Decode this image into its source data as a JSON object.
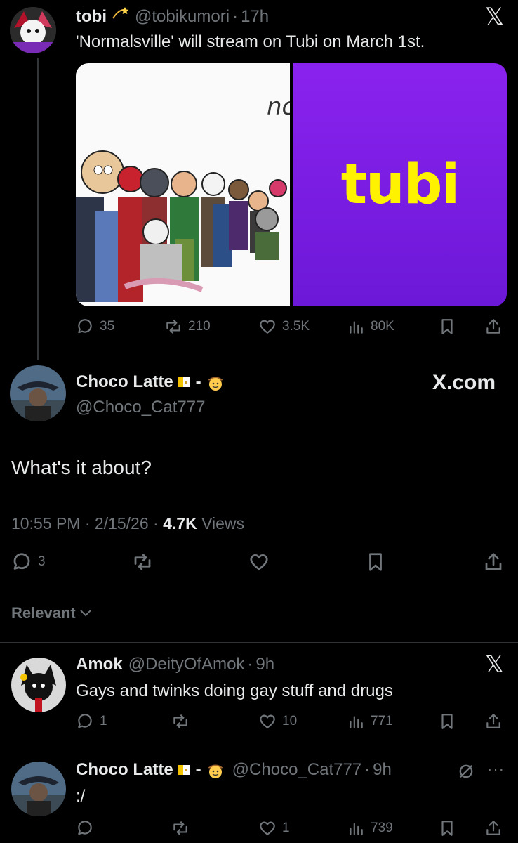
{
  "post1": {
    "name": "tobi",
    "handle": "@tobikumori",
    "time": "17h",
    "text": "'Normalsville' will stream on Tubi on March 1st.",
    "image_left_caption": "nc",
    "image_right_logo": "tubi",
    "replies": "35",
    "reposts": "210",
    "likes": "3.5K",
    "views": "80K"
  },
  "main": {
    "name": "Choco Latte",
    "separator": "-",
    "handle": "@Choco_Cat777",
    "watermark": "X.com",
    "text": "What's it about?",
    "time": "10:55 PM",
    "date": "2/15/26",
    "views_count": "4.7K",
    "views_label": "Views",
    "replies": "3"
  },
  "filter": {
    "label": "Relevant"
  },
  "reply1": {
    "name": "Amok",
    "handle": "@DeityOfAmok",
    "time": "9h",
    "text": "Gays and twinks doing gay stuff and drugs",
    "replies": "1",
    "likes": "10",
    "views": "771"
  },
  "reply2": {
    "name": "Choco Latte",
    "separator": "-",
    "handle": "@Choco_Cat777",
    "time": "9h",
    "text": ":/",
    "likes": "1",
    "views": "739"
  },
  "colors": {
    "tubi_purple": "#7b1de6",
    "tubi_yellow": "#fff200",
    "background": "#000000",
    "secondary_text": "#71767b"
  }
}
